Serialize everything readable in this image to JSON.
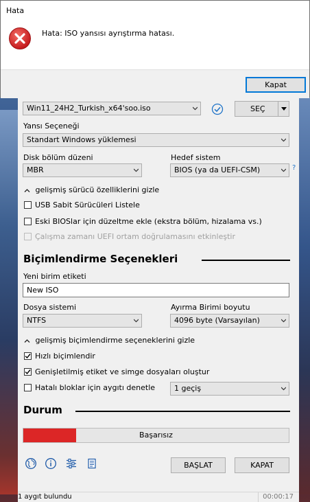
{
  "dialog": {
    "title": "Hata",
    "message": "Hata: ISO yansısı ayrıştırma hatası.",
    "close_button": "Kapat",
    "icon": "error-icon"
  },
  "drive": {
    "boot_selection": "Win11_24H2_Turkish_x64'soo.iso",
    "select_button": "SEÇ"
  },
  "image_option": {
    "label": "Yansı Seçeneği",
    "value": "Standart Windows yüklemesi"
  },
  "partition": {
    "label": "Disk bölüm düzeni",
    "value": "MBR"
  },
  "target": {
    "label": "Hedef sistem",
    "value": "BIOS (ya da UEFI-CSM)",
    "help": "?"
  },
  "advanced_drive": {
    "toggle_label": "gelişmiş sürücü özelliklerini gizle",
    "list_usb": "USB Sabit Sürücüleri Listele",
    "old_bios": "Eski BIOSlar için düzeltme ekle (ekstra bölüm, hizalama vs.)",
    "uefi_validation": "Çalışma zamanı UEFI ortam doğrulamasını etkinleştir"
  },
  "format_section": {
    "title": "Biçimlendirme Seçenekleri",
    "volume_label": "Yeni birim etiketi",
    "volume_value": "New ISO",
    "fs_label": "Dosya sistemi",
    "fs_value": "NTFS",
    "cluster_label": "Ayırma Birimi boyutu",
    "cluster_value": "4096 byte (Varsayılan)"
  },
  "advanced_format": {
    "toggle_label": "gelişmiş biçimlendirme seçeneklerini gizle",
    "quick_format": "Hızlı biçimlendir",
    "extended_label": "Genişletilmiş etiket ve simge dosyaları oluştur",
    "bad_blocks": "Hatalı bloklar için aygıtı denetle",
    "passes_value": "1 geçiş"
  },
  "status_section": {
    "title": "Durum",
    "progress_text": "Başarısız",
    "progress_fraction": 0.2
  },
  "footer": {
    "start_button": "BAŞLAT",
    "close_button": "KAPAT"
  },
  "statusbar": {
    "left": "1 aygıt bulundu",
    "right": "00:00:17"
  },
  "colors": {
    "progress_fail": "#dc2626",
    "check_ok": "#1e73c8"
  }
}
